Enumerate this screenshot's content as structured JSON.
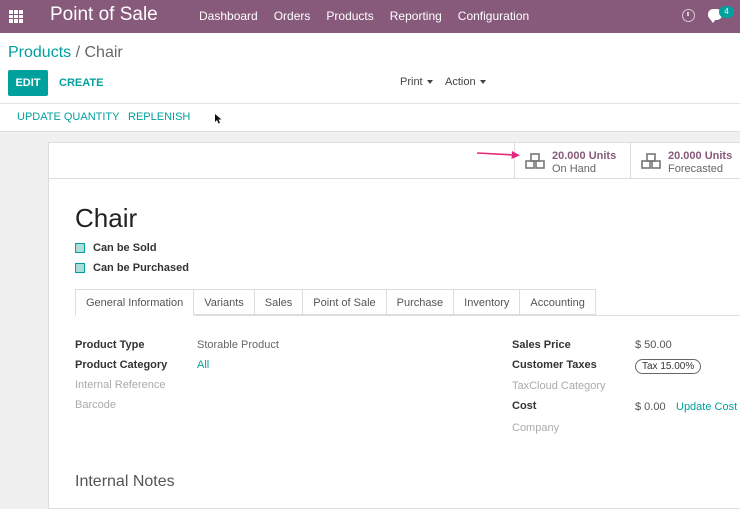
{
  "navbar": {
    "brand": "Point of Sale",
    "menu": [
      "Dashboard",
      "Orders",
      "Products",
      "Reporting",
      "Configuration"
    ],
    "chat_count": "4",
    "color": "#875a7b"
  },
  "breadcrumb": {
    "parent": "Products",
    "separator": "/",
    "current": "Chair"
  },
  "toolbar": {
    "edit": "EDIT",
    "create": "CREATE",
    "print": "Print",
    "action": "Action"
  },
  "header_buttons": {
    "update_quantity": "UPDATE QUANTITY",
    "replenish": "REPLENISH"
  },
  "stats": [
    {
      "value": "20.000 Units",
      "label": "On Hand",
      "icon": "cubes-icon"
    },
    {
      "value": "20.000 Units",
      "label": "Forecasted",
      "icon": "cubes-icon"
    }
  ],
  "product": {
    "name": "Chair",
    "can_be_sold": "Can be Sold",
    "can_be_purchased": "Can be Purchased"
  },
  "tabs": [
    "General Information",
    "Variants",
    "Sales",
    "Point of Sale",
    "Purchase",
    "Inventory",
    "Accounting"
  ],
  "left_fields": [
    {
      "label": "Product Type",
      "value": "Storable Product"
    },
    {
      "label": "Product Category",
      "value": "All"
    },
    {
      "label": "Internal Reference",
      "value": ""
    },
    {
      "label": "Barcode",
      "value": ""
    }
  ],
  "right_fields": [
    {
      "label": "Sales Price",
      "value": "$ 50.00"
    },
    {
      "label": "Customer Taxes",
      "value": "Tax 15.00%"
    },
    {
      "label": "TaxCloud Category",
      "value": ""
    },
    {
      "label": "Cost",
      "value": "$ 0.00"
    },
    {
      "label": "Company",
      "value": ""
    }
  ],
  "update_cost": "Update Cost",
  "internal_notes": "Internal Notes",
  "accent": "#00a09d"
}
